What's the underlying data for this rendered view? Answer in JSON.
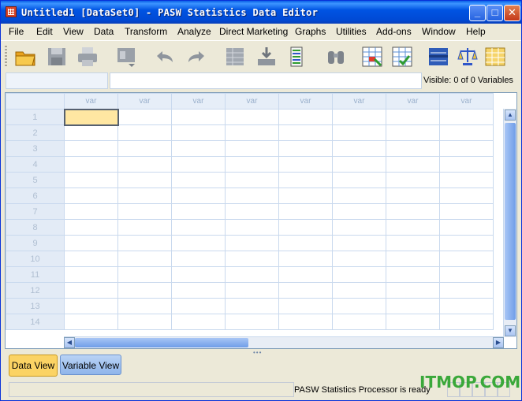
{
  "window": {
    "title": "Untitled1 [DataSet0] - PASW Statistics Data Editor",
    "controls": {
      "minimize": "_",
      "maximize": "□",
      "close": "✕"
    }
  },
  "menubar": {
    "items": [
      {
        "label": "File"
      },
      {
        "label": "Edit"
      },
      {
        "label": "View"
      },
      {
        "label": "Data"
      },
      {
        "label": "Transform"
      },
      {
        "label": "Analyze"
      },
      {
        "label": "Direct Marketing"
      },
      {
        "label": "Graphs"
      },
      {
        "label": "Utilities"
      },
      {
        "label": "Add-ons"
      },
      {
        "label": "Window"
      },
      {
        "label": "Help"
      }
    ]
  },
  "toolbar": {
    "icons": [
      "open-folder-icon",
      "save-icon",
      "print-icon",
      "dialog-recall-icon",
      "undo-icon",
      "redo-icon",
      "goto-case-icon",
      "goto-variable-icon",
      "variables-icon",
      "find-icon",
      "insert-cases-icon",
      "insert-variable-icon",
      "split-file-icon",
      "weight-cases-icon",
      "select-cases-icon"
    ]
  },
  "cell_editor": {
    "cell_ref": "",
    "value": "",
    "visible_label": "Visible: 0 of 0 Variables"
  },
  "grid": {
    "column_header": "var",
    "column_count": 8,
    "rows": [
      "1",
      "2",
      "3",
      "4",
      "5",
      "6",
      "7",
      "8",
      "9",
      "10",
      "11",
      "12",
      "13",
      "14"
    ]
  },
  "view_tabs": {
    "data_view": "Data View",
    "variable_view": "Variable View"
  },
  "status": {
    "processor": "PASW Statistics Processor is ready"
  },
  "watermark": "ITMOP.COM",
  "colors": {
    "title_bar": "#0054e3",
    "active_cell": "#ffe7a2",
    "active_tab": "#fbd364",
    "watermark": "#3aa83a"
  }
}
